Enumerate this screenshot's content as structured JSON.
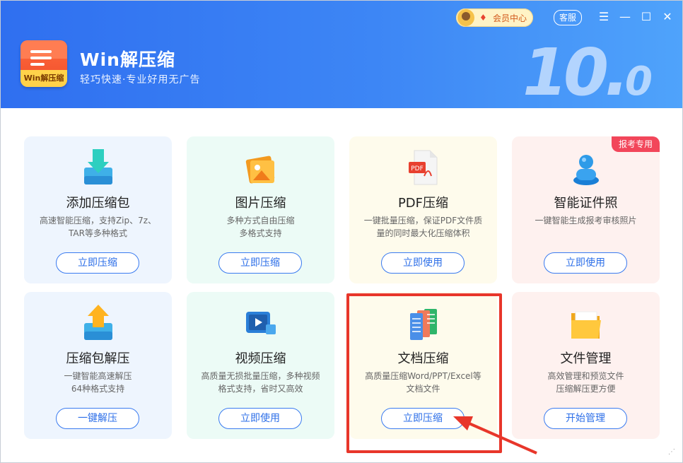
{
  "app": {
    "logo_text": "Win解压缩",
    "title": "Win解压缩",
    "subtitle": "轻巧快速·专业好用无广告",
    "version": "10.0"
  },
  "titlebar": {
    "member_label": "会员中心",
    "service_label": "客服"
  },
  "cards": [
    {
      "title": "添加压缩包",
      "desc": "高速智能压缩，支持Zip、7z、\nTAR等多种格式",
      "button": "立即压缩",
      "icon": "download-box-icon"
    },
    {
      "title": "图片压缩",
      "desc": "多种方式自由压缩\n多格式支持",
      "button": "立即压缩",
      "icon": "image-icon"
    },
    {
      "title": "PDF压缩",
      "desc": "一键批量压缩，保证PDF文件质\n量的同时最大化压缩体积",
      "button": "立即使用",
      "icon": "pdf-icon"
    },
    {
      "title": "智能证件照",
      "desc": "一键智能生成报考审核照片",
      "button": "立即使用",
      "icon": "person-icon",
      "tag": "报考专用"
    },
    {
      "title": "压缩包解压",
      "desc": "一键智能高速解压\n64种格式支持",
      "button": "一键解压",
      "icon": "upload-box-icon"
    },
    {
      "title": "视频压缩",
      "desc": "高质量无损批量压缩，多种视频\n格式支持，省时又高效",
      "button": "立即使用",
      "icon": "video-icon"
    },
    {
      "title": "文档压缩",
      "desc": "高质量压缩Word/PPT/Excel等\n文档文件",
      "button": "立即压缩",
      "icon": "documents-icon"
    },
    {
      "title": "文件管理",
      "desc": "高效管理和预览文件\n压缩解压更方便",
      "button": "开始管理",
      "icon": "folder-icon"
    }
  ],
  "colors": {
    "header_blue": "#3d86f5",
    "accent_blue": "#2d6fe8",
    "highlight_red": "#e8362a",
    "tag_red": "#f2465a"
  }
}
